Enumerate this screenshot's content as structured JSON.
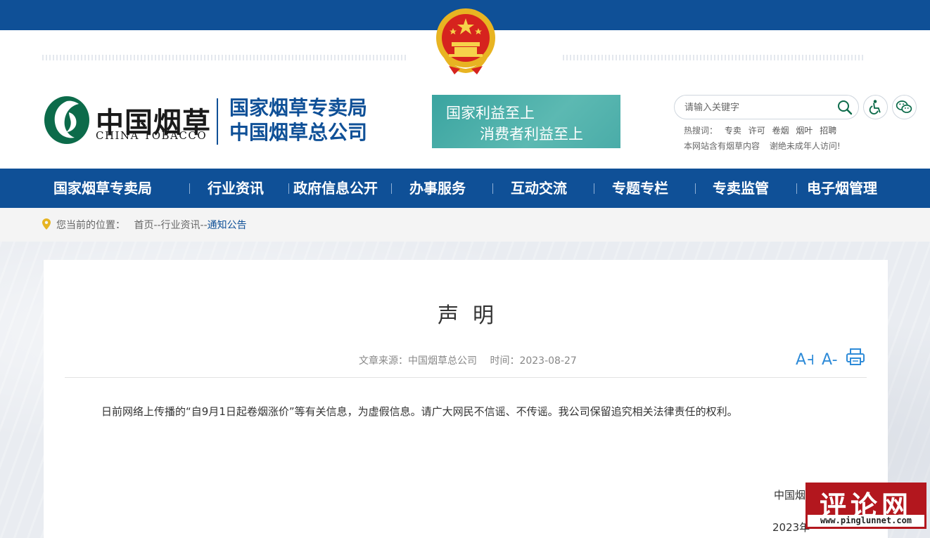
{
  "header": {
    "logo": {
      "cn": "中国烟草",
      "en": "CHINA TOBACCO",
      "bureau_line1": "国家烟草专卖局",
      "bureau_line2": "中国烟草总公司"
    },
    "slogan": {
      "line1": "国家利益至上",
      "line2": "消费者利益至上"
    },
    "search": {
      "placeholder": "请输入关键字"
    },
    "hot_label": "热搜词：",
    "hot_keywords": [
      "专卖",
      "许可",
      "卷烟",
      "烟叶",
      "招聘"
    ],
    "notice": [
      "本网站含有烟草内容",
      "谢绝未成年人访问!"
    ]
  },
  "nav": [
    "国家烟草专卖局",
    "行业资讯",
    "政府信息公开",
    "办事服务",
    "互动交流",
    "专题专栏",
    "专卖监管",
    "电子烟管理"
  ],
  "breadcrumb": {
    "label": "您当前的位置：",
    "path": "首页--行业资讯--",
    "current": "通知公告"
  },
  "article": {
    "title": "声明",
    "source": "文章来源：中国烟草总公司",
    "time": "时间：2023-08-27",
    "font_increase": "A+",
    "font_decrease": "A-",
    "body": "日前网络上传播的“自9月1日起卷烟涨价”等有关信息，为虚假信息。请广大网民不信谣、不传谣。我公司保留追究相关法律责任的权利。",
    "signature_org": "中国烟",
    "signature_date": "2023年"
  },
  "watermark": {
    "cn": "评论网",
    "url": "www.pinglunnet.com"
  },
  "colors": {
    "brand_blue": "#0f5097",
    "slogan_teal": "#4aaca8",
    "watermark_red": "#b3171e",
    "icon_blue": "#2e8bd8"
  }
}
